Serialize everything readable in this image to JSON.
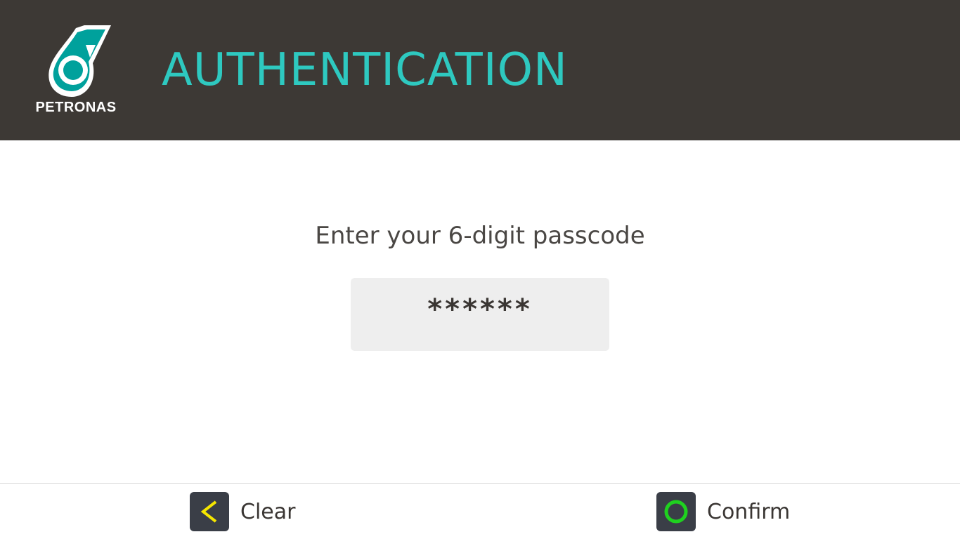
{
  "header": {
    "logo_text": "PETRONAS",
    "title": "AUTHENTICATION"
  },
  "main": {
    "prompt": "Enter your 6-digit passcode",
    "passcode_value": "******"
  },
  "footer": {
    "clear_label": "Clear",
    "clear_icon": "chevron-left-icon",
    "confirm_label": "Confirm",
    "confirm_icon": "circle-icon"
  },
  "colors": {
    "header_bg": "#3d3935",
    "title_accent": "#2ec9c0",
    "logo_teal": "#00a19c",
    "clear_icon_color": "#f5e600",
    "confirm_icon_color": "#1fd11f",
    "key_bg": "#3a3e47",
    "passcode_bg": "#eeeeee"
  }
}
